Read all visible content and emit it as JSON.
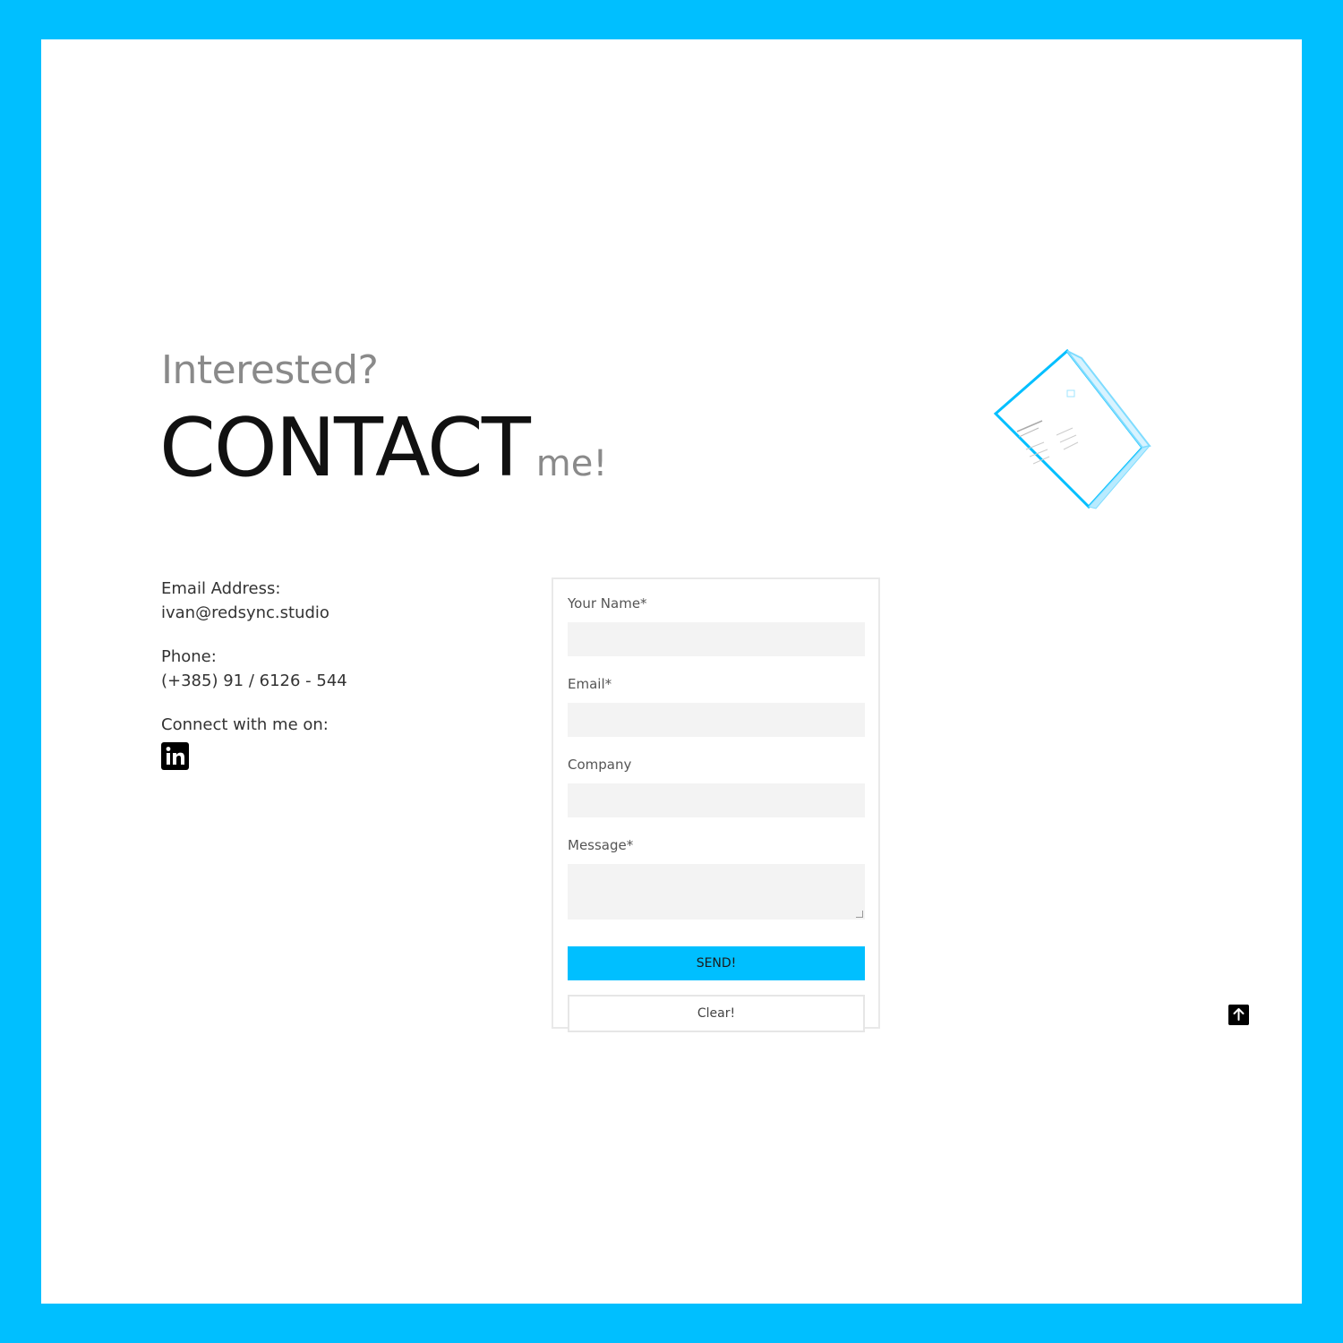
{
  "heading": {
    "line1": "Interested?",
    "main": "CONTACT",
    "suffix": "me!"
  },
  "contact": {
    "email_label": "Email Address:",
    "email_value": "ivan@redsync.studio",
    "phone_label": "Phone:",
    "phone_value": "(+385) 91 / 6126 - 544",
    "connect_label": "Connect with me on:",
    "social_icon": "linkedin-icon"
  },
  "form": {
    "name_label": "Your Name*",
    "email_label": "Email*",
    "company_label": "Company",
    "message_label": "Message*",
    "send_label": "SEND!",
    "clear_label": "Clear!"
  },
  "scroll_top_icon": "arrow-up-icon",
  "colors": {
    "accent": "#00BFFF",
    "frame": "#00BFFF",
    "field_bg": "#f3f3f3"
  }
}
